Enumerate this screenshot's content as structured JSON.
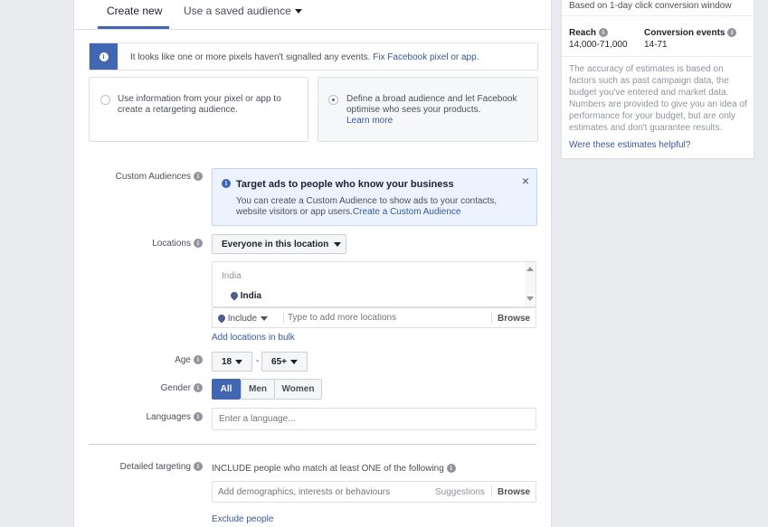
{
  "tabs": {
    "create_new": "Create new",
    "saved": "Use a saved audience"
  },
  "pixel_warning": {
    "text": "It looks like one or more pixels haven't signalled any events.",
    "link": "Fix Facebook pixel or app."
  },
  "options": {
    "retarget": {
      "line1": "Use information from your pixel or app to",
      "line2": "create a retargeting audience."
    },
    "broad": {
      "line1": "Define a broad audience and let Facebook",
      "line2": "optimise who sees your products.",
      "link": "Learn more"
    }
  },
  "custom_audiences": {
    "label": "Custom Audiences",
    "title": "Target ads to people who know your business",
    "line1": "You can create a Custom Audience to show ads to your contacts,",
    "line2": "website visitors or app users.",
    "link": "Create a Custom Audience"
  },
  "locations": {
    "label": "Locations",
    "dropdown": "Everyone in this location",
    "group": "India",
    "item": "India",
    "include": "Include",
    "placeholder": "Type to add more locations",
    "browse": "Browse",
    "bulk": "Add locations in bulk"
  },
  "age": {
    "label": "Age",
    "min": "18",
    "sep": "-",
    "max": "65+"
  },
  "gender": {
    "label": "Gender",
    "all": "All",
    "men": "Men",
    "women": "Women"
  },
  "languages": {
    "label": "Languages",
    "placeholder": "Enter a language..."
  },
  "detailed": {
    "label": "Detailed targeting",
    "include_text": "INCLUDE people who match at least ONE of the following",
    "placeholder": "Add demographics, interests or behaviours",
    "suggestions": "Suggestions",
    "browse": "Browse",
    "exclude": "Exclude people"
  },
  "estimate": {
    "window": "Based on 1-day click conversion window",
    "reach_label": "Reach",
    "reach_value": "14,000-71,000",
    "conv_label": "Conversion events",
    "conv_value": "14-71",
    "desc": [
      "The accuracy of estimates is based on",
      "factors such as past campaign data, the",
      "budget you've entered and market data.",
      "Numbers are provided to give you an idea of",
      "performance for your budget, but are only",
      "estimates and don't guarantee results."
    ],
    "helpful": "Were these estimates helpful?"
  },
  "colors": {
    "accent": "#4267b2",
    "link": "#365899",
    "info_bg": "#ecf3ff"
  }
}
